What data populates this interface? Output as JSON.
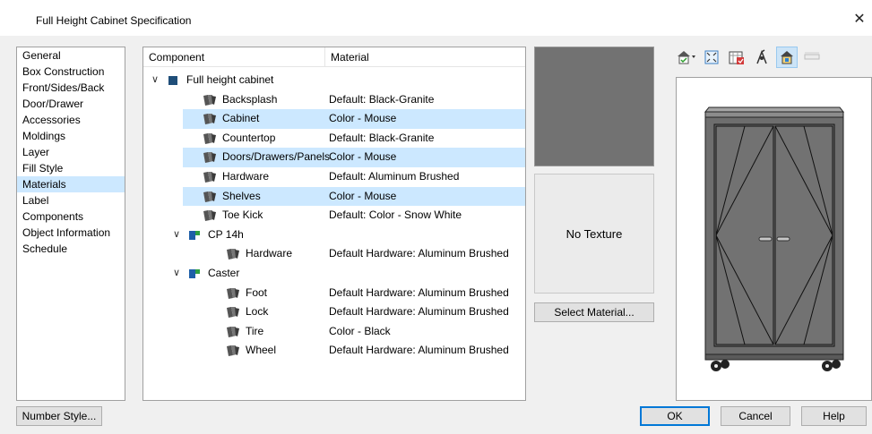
{
  "window": {
    "title": "Full Height Cabinet Specification",
    "close_glyph": "✕"
  },
  "nav": {
    "items": [
      {
        "label": "General",
        "selected": false
      },
      {
        "label": "Box Construction",
        "selected": false
      },
      {
        "label": "Front/Sides/Back",
        "selected": false
      },
      {
        "label": "Door/Drawer",
        "selected": false
      },
      {
        "label": "Accessories",
        "selected": false
      },
      {
        "label": "Moldings",
        "selected": false
      },
      {
        "label": "Layer",
        "selected": false
      },
      {
        "label": "Fill Style",
        "selected": false
      },
      {
        "label": "Materials",
        "selected": true
      },
      {
        "label": "Label",
        "selected": false
      },
      {
        "label": "Components",
        "selected": false
      },
      {
        "label": "Object Information",
        "selected": false
      },
      {
        "label": "Schedule",
        "selected": false
      }
    ]
  },
  "tree": {
    "headers": {
      "component": "Component",
      "material": "Material"
    },
    "rows": [
      {
        "level": 0,
        "type": "object",
        "expanded": true,
        "component": "Full height cabinet",
        "material": "",
        "selected": false
      },
      {
        "level": 1,
        "type": "material",
        "component": "Backsplash",
        "material": "Default: Black-Granite",
        "selected": false
      },
      {
        "level": 1,
        "type": "material",
        "component": "Cabinet",
        "material": "Color - Mouse",
        "selected": true
      },
      {
        "level": 1,
        "type": "material",
        "component": "Countertop",
        "material": "Default: Black-Granite",
        "selected": false
      },
      {
        "level": 1,
        "type": "material",
        "component": "Doors/Drawers/Panels",
        "material": "Color - Mouse",
        "selected": true
      },
      {
        "level": 1,
        "type": "material",
        "component": "Hardware",
        "material": "Default: Aluminum Brushed",
        "selected": false
      },
      {
        "level": 1,
        "type": "material",
        "component": "Shelves",
        "material": "Color - Mouse",
        "selected": true
      },
      {
        "level": 1,
        "type": "material",
        "component": "Toe Kick",
        "material": "Default: Color - Snow White",
        "selected": false
      },
      {
        "level": 1,
        "type": "symbol",
        "expanded": true,
        "component": "CP 14h",
        "material": "",
        "selected": false
      },
      {
        "level": 2,
        "type": "material",
        "component": "Hardware",
        "material": "Default Hardware: Aluminum Brushed",
        "selected": false
      },
      {
        "level": 1,
        "type": "symbol",
        "expanded": true,
        "component": "Caster",
        "material": "",
        "selected": false
      },
      {
        "level": 2,
        "type": "material",
        "component": "Foot",
        "material": "Default Hardware: Aluminum Brushed",
        "selected": false
      },
      {
        "level": 2,
        "type": "material",
        "component": "Lock",
        "material": "Default Hardware: Aluminum Brushed",
        "selected": false
      },
      {
        "level": 2,
        "type": "material",
        "component": "Tire",
        "material": "Color - Black",
        "selected": false
      },
      {
        "level": 2,
        "type": "material",
        "component": "Wheel",
        "material": "Default Hardware: Aluminum Brushed",
        "selected": false
      }
    ]
  },
  "material_panel": {
    "swatch_color": "#727272",
    "texture_text": "No Texture",
    "select_button": "Select Material..."
  },
  "toolbar": {
    "icons": [
      "camera-view-icon",
      "fit-view-icon",
      "render-mode-icon",
      "orbit-icon",
      "object-view-icon",
      "extra-option-icon"
    ]
  },
  "footer": {
    "number_style": "Number Style...",
    "ok": "OK",
    "cancel": "Cancel",
    "help": "Help"
  },
  "colors": {
    "selection": "#cce8ff",
    "object_icon": "#1f4e79",
    "symbol_icon_blue": "#1f5fa8",
    "symbol_icon_green": "#2ea043"
  }
}
